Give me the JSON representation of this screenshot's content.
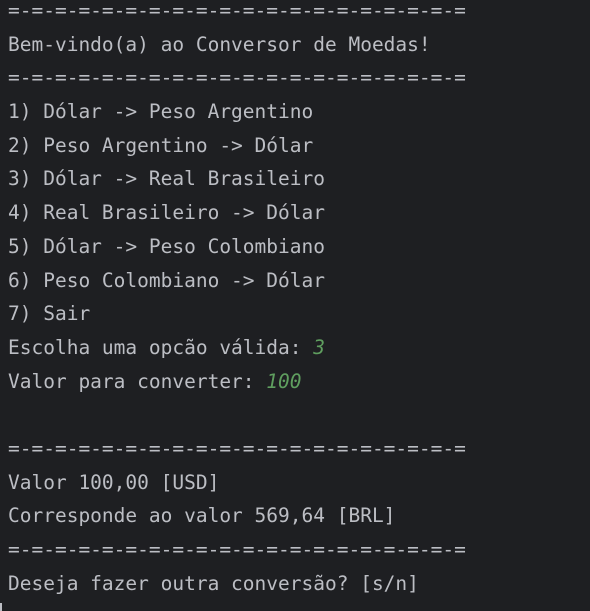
{
  "console": {
    "separator": "=-=-=-=-=-=-=-=-=-=-=-=-=-=-=-=-=-=-=-=",
    "welcome": "Bem-vindo(a) ao Conversor de Moedas!",
    "menu": [
      "1) Dólar -> Peso Argentino",
      "2) Peso Argentino -> Dólar",
      "3) Dólar -> Real Brasileiro",
      "4) Real Brasileiro -> Dólar",
      "5) Dólar -> Peso Colombiano",
      "6) Peso Colombiano -> Dólar",
      "7) Sair"
    ],
    "choice_prompt": "Escolha uma opcão válida: ",
    "choice_value": "3",
    "amount_prompt": "Valor para converter: ",
    "amount_value": "100",
    "result_value_line": "Valor 100,00 [USD]",
    "result_converted_line": "Corresponde ao valor 569,64 [BRL]",
    "again_prompt": "Deseja fazer outra conversão? [s/n]"
  },
  "colors": {
    "background": "#1e1f22",
    "text": "#bcbec4",
    "user_input": "#5f9e5f"
  }
}
